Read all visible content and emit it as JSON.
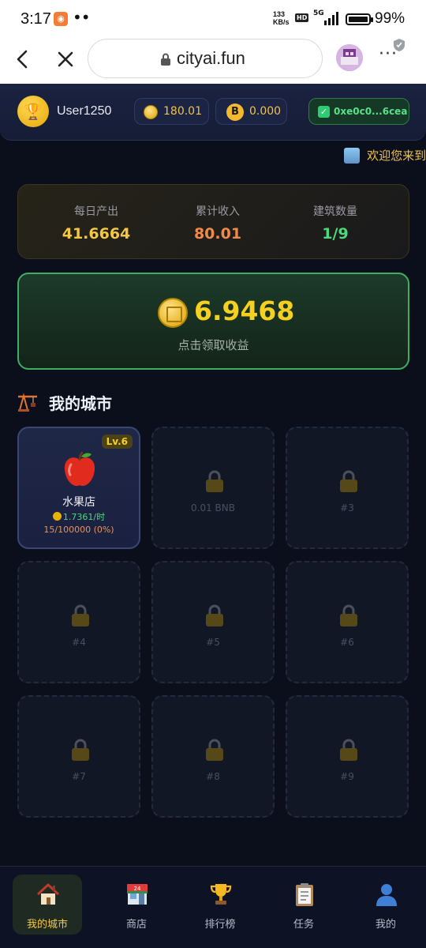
{
  "status_bar": {
    "time": "3:17",
    "net_speed_value": "133",
    "net_speed_unit": "KB/s",
    "hd_label": "HD",
    "network": "5G",
    "battery_percent": "99%",
    "battery_level": 0.99
  },
  "browser": {
    "url": "cityai.fun",
    "menu_glyph": "···"
  },
  "header": {
    "username": "User1250",
    "coin_balance": "180.01",
    "bnb_symbol": "B",
    "bnb_balance": "0.000",
    "wallet_address": "0xe0c0...6cea"
  },
  "marquee": {
    "text": "欢迎您来到"
  },
  "stats": {
    "daily_output_label": "每日产出",
    "daily_output_value": "41.6664",
    "total_income_label": "累计收入",
    "total_income_value": "80.01",
    "building_count_label": "建筑数量",
    "building_count_value": "1/9"
  },
  "claim": {
    "amount": "6.9468",
    "hint": "点击领取收益"
  },
  "city": {
    "title": "我的城市",
    "slots": [
      {
        "level": "Lv.6",
        "name": "水果店",
        "rate": "1.7361/时",
        "progress": "15/100000 (0%)"
      },
      {
        "label": "0.01 BNB"
      },
      {
        "label": "#3"
      },
      {
        "label": "#4"
      },
      {
        "label": "#5"
      },
      {
        "label": "#6"
      },
      {
        "label": "#7"
      },
      {
        "label": "#8"
      },
      {
        "label": "#9"
      }
    ]
  },
  "nav": [
    {
      "label": "我的城市",
      "icon": "house-icon",
      "active": true
    },
    {
      "label": "商店",
      "icon": "store-icon",
      "active": false
    },
    {
      "label": "排行榜",
      "icon": "trophy-icon",
      "active": false
    },
    {
      "label": "任务",
      "icon": "clipboard-icon",
      "active": false
    },
    {
      "label": "我的",
      "icon": "user-icon",
      "active": false
    }
  ],
  "colors": {
    "background": "#0b0f1c",
    "gold": "#f5c842",
    "green": "#4cd97b",
    "orange": "#f08a4b",
    "claim_border": "#3fae63"
  }
}
